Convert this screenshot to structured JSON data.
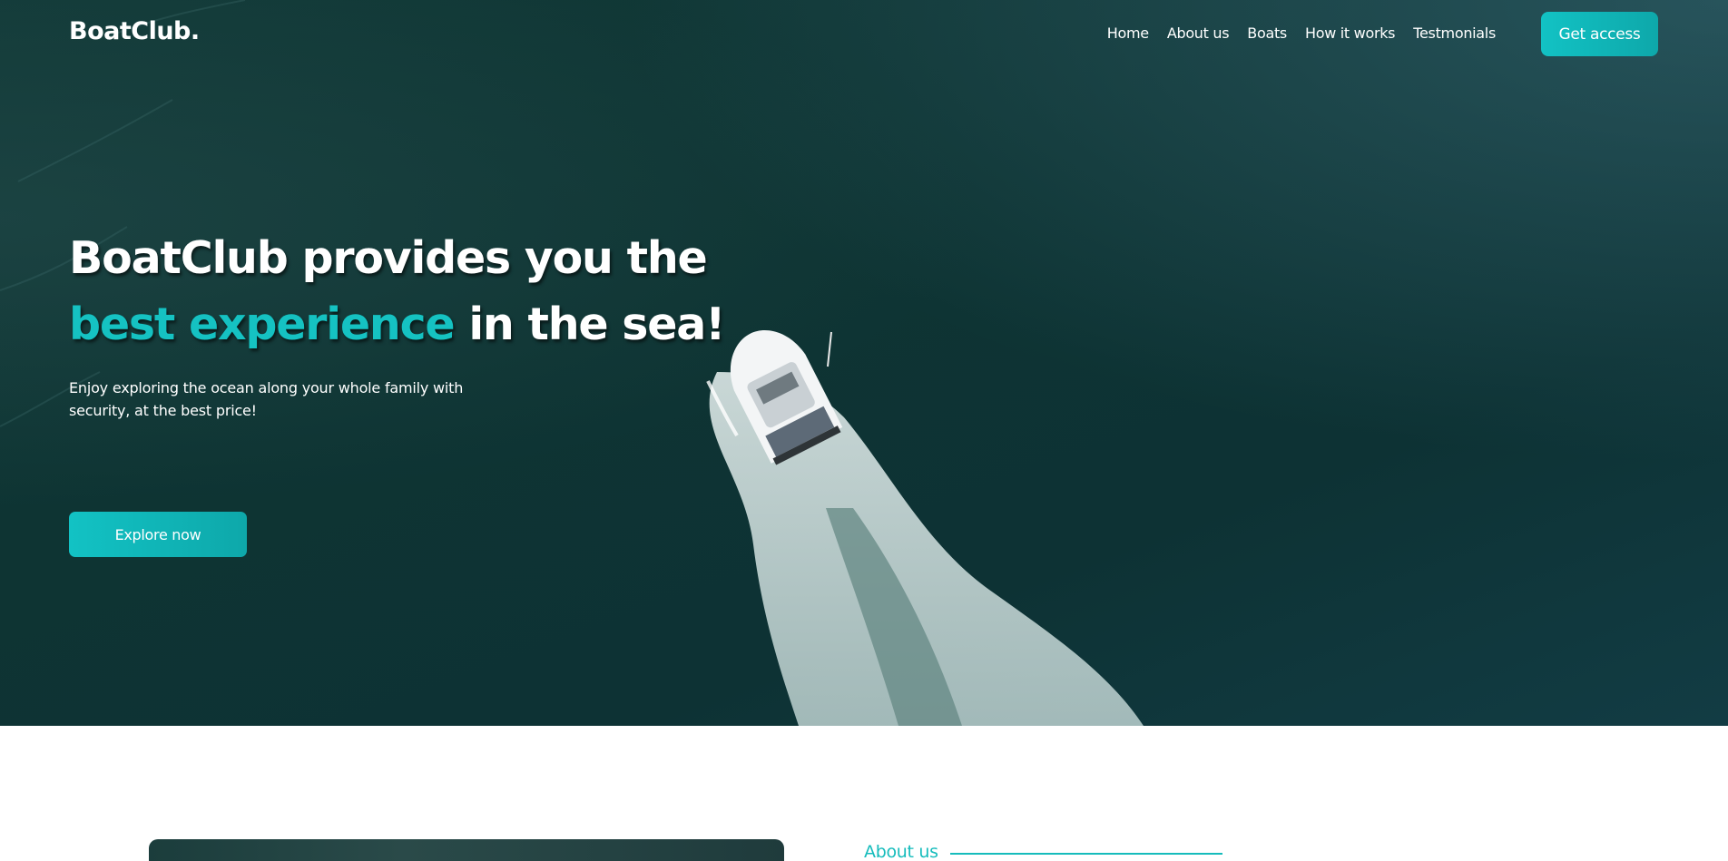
{
  "brand": {
    "logo": "BoatClub."
  },
  "nav": {
    "links": [
      "Home",
      "About us",
      "Boats",
      "How it works",
      "Testmonials"
    ],
    "cta_label": "Get access"
  },
  "hero": {
    "headline_part1": "BoatClub provides you the ",
    "headline_accent": "best experience",
    "headline_part2": " in the sea!",
    "subtitle": "Enjoy exploring the ocean along your whole family with security, at the best price!",
    "button_label": "Explore now",
    "image": "aerial-boat-on-ocean"
  },
  "about": {
    "label": "About us"
  },
  "colors": {
    "accent": "#15c2c2",
    "ocean_dark": "#0e3433",
    "white": "#ffffff"
  }
}
